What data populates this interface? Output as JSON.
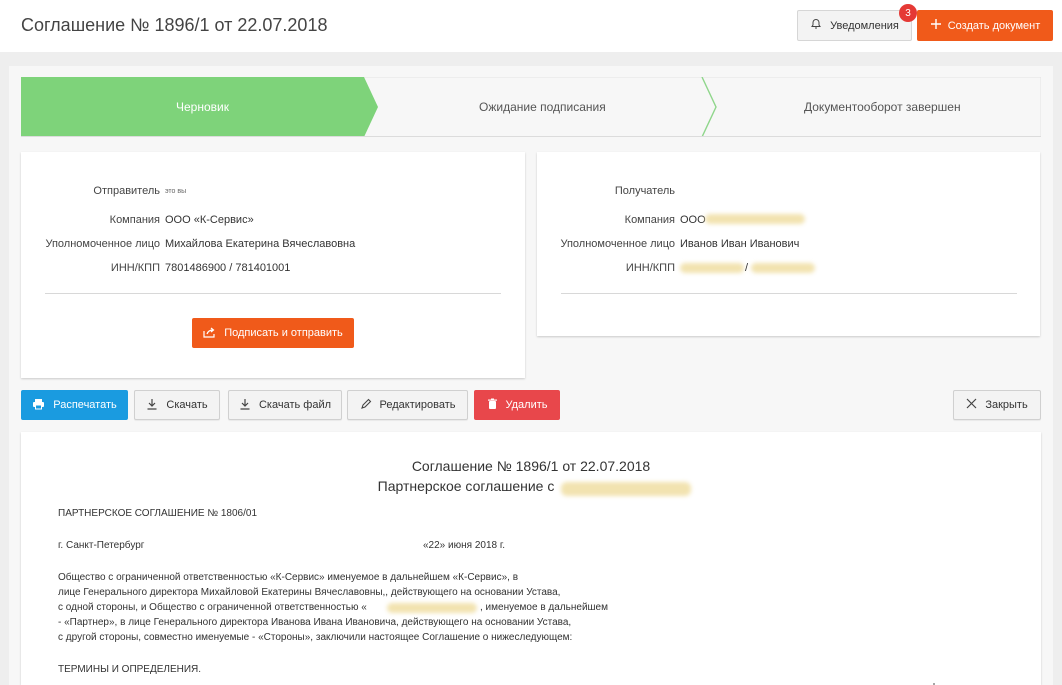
{
  "header": {
    "title": "Соглашение № 1896/1 от 22.07.2018",
    "notifications_label": "Уведомления",
    "notifications_count": "3",
    "create_label": "Создать документ"
  },
  "stepper": {
    "steps": [
      {
        "label": "Черновик",
        "state": "active"
      },
      {
        "label": "Ожидание подписания",
        "state": "pending"
      },
      {
        "label": "Документооборот завершен",
        "state": "pending"
      }
    ],
    "active_color": "#7ed37a"
  },
  "sender": {
    "title_label": "Отправитель",
    "title_value": "это вы",
    "company_label": "Компания",
    "company_value": "ООО «К-Сервис»",
    "person_label": "Уполномоченное лицо",
    "person_value": "Михайлова Екатерина Вячеславовна",
    "inn_label": "ИНН/КПП",
    "inn_value": "7801486900 / 781401001",
    "sign_button": "Подписать и отправить"
  },
  "recipient": {
    "title_label": "Получатель",
    "company_label": "Компания",
    "company_value": "ООО",
    "person_label": "Уполномоченное лицо",
    "person_value": "Иванов Иван Иванович",
    "inn_label": "ИНН/КПП",
    "inn_separator": "/"
  },
  "toolbar": {
    "print": "Распечатать",
    "download": "Скачать",
    "download_file": "Скачать файл",
    "edit": "Редактировать",
    "delete": "Удалить",
    "close": "Закрыть"
  },
  "document": {
    "title": "Соглашение № 1896/1 от 22.07.2018",
    "subtitle": "Партнерское соглашение с",
    "heading": "ПАРТНЕРСКОЕ СОГЛАШЕНИЕ № 1806/01",
    "city": "г. Санкт-Петербург",
    "date": "«22» июня 2018 г.",
    "p1": "Общество с ограниченной ответственностью «К-Сервис» именуемое в дальнейшем «К-Сервис», в",
    "p2": "лице Генерального директора Михайловой Екатерины Вячеславовны,, действующего на основании Устава,",
    "p3a": "с одной стороны, и Общество с ограниченной ответственностью «",
    "p3b": ", именуемое в дальнейшем",
    "p4": "- «Партнер», в лице Генерального директора Иванова Ивана Ивановича, действующего на основании Устава,",
    "p5": "с другой стороны, совместно именуемые - «Стороны», заключили настоящее Соглашение о нижеследующем:",
    "section": "ТЕРМИНЫ И ОПРЕДЕЛЕНИЯ."
  }
}
